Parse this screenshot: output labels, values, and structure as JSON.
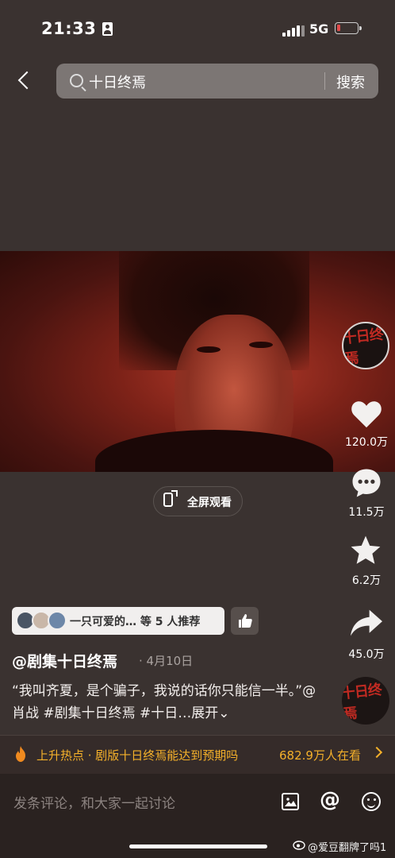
{
  "status_bar": {
    "time": "21:33",
    "network": "5G"
  },
  "search": {
    "query": "十日终焉",
    "button": "搜索"
  },
  "fullscreen_label": "全屏观看",
  "rail": {
    "likes": "120.0万",
    "comments": "11.5万",
    "favorites": "6.2万",
    "shares": "45.0万"
  },
  "recommend": {
    "text": "一只可爱的… 等 5 人推荐"
  },
  "post": {
    "author": "@剧集十日终焉",
    "date": "· 4月10日",
    "caption": "“我叫齐夏，是个骗子，我说的话你只能信一半。”@肖战 #剧集十日终焉 #十日…展开⌄"
  },
  "hot": {
    "text": "上升热点 · 剧版十日终焉能达到预期吗",
    "count": "682.9万人在看"
  },
  "comment_placeholder": "发条评论，和大家一起讨论",
  "watermark": "@爱豆翻牌了吗1",
  "colors": {
    "accent": "#f4b02a",
    "background": "#3a3230"
  }
}
